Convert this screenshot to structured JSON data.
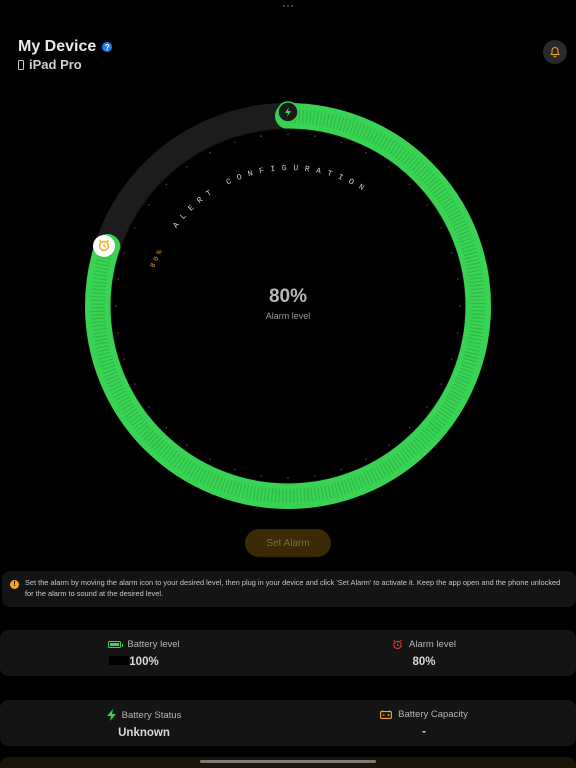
{
  "header": {
    "title": "My Device",
    "device_name": "iPad Pro",
    "help_glyph": "?"
  },
  "dial": {
    "arc_text": "ALERT CONFIGURATION",
    "marker_text": "80%",
    "center_value": "80%",
    "center_label": "Alarm level",
    "level_fraction": 0.8,
    "track_color": "#1c1c1c",
    "fill_color": "#39d353",
    "alarm_accent": "#f5a623"
  },
  "set_alarm_label": "Set Alarm",
  "info": {
    "icon_glyph": "!",
    "text": "Set the alarm by moving the alarm icon to your desired level, then plug in your device and click 'Set Alarm' to activate it. Keep the app open and the phone unlocked for the alarm to sound at the desired level."
  },
  "stats": {
    "battery_level_label": "Battery level",
    "battery_level_value": "100%",
    "alarm_level_label": "Alarm level",
    "alarm_level_value": "80%",
    "battery_status_label": "Battery Status",
    "battery_status_value": "Unknown",
    "battery_capacity_label": "Battery Capacity",
    "battery_capacity_value": "-"
  },
  "icons": [
    "help-icon",
    "phone-icon",
    "bell-icon",
    "charging-icon",
    "alarm-clock-icon",
    "info-icon",
    "battery-icon",
    "bolt-icon",
    "battery-capacity-icon"
  ]
}
